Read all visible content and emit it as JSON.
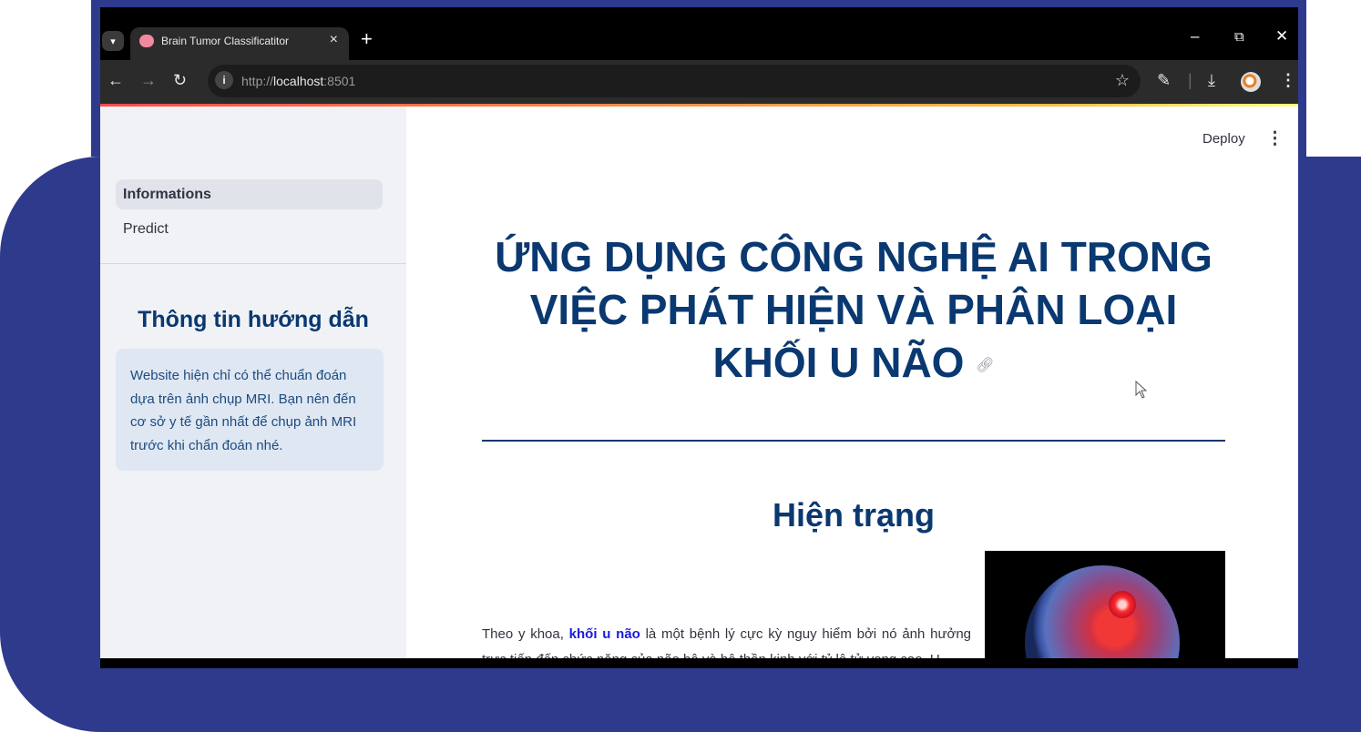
{
  "colors": {
    "backdrop": "#2e3a8c",
    "heading": "#0a3870",
    "sidebar_bg": "#f0f2f6",
    "info_box_bg": "#dfe7f2"
  },
  "browser": {
    "tab_title": "Brain Tumor Classificatitor",
    "url_scheme": "http://",
    "url_host": "localhost",
    "url_port": ":8501",
    "icons": [
      "tab-search-icon",
      "brain-favicon-icon",
      "close-icon",
      "new-tab-icon",
      "minimize-icon",
      "restore-icon",
      "window-close-icon",
      "back-icon",
      "forward-icon",
      "reload-icon",
      "site-info-icon",
      "bookmark-star-icon",
      "extensions-icon",
      "download-icon",
      "profile-avatar",
      "browser-menu-icon"
    ]
  },
  "app": {
    "deploy_label": "Deploy",
    "sidebar": {
      "nav": [
        {
          "label": "Informations",
          "active": true
        },
        {
          "label": "Predict",
          "active": false
        }
      ],
      "heading": "Thông tin hướng dẫn",
      "info_text": "Website hiện chỉ có thể chuẩn đoán dựa trên ảnh chụp MRI. Bạn nên đến cơ sở y tế gần nhất để chụp ảnh MRI trước khi chẩn đoán nhé."
    },
    "main": {
      "title": "ỨNG DỤNG CÔNG NGHỆ AI TRONG VIỆC PHÁT HIỆN VÀ PHÂN LOẠI KHỐI U NÃO",
      "section_heading": "Hiện trạng",
      "body_prefix": "Theo y khoa, ",
      "body_highlight": "khối u não",
      "body_rest": " là một bệnh lý cực kỳ nguy hiểm bởi nó ảnh hưởng trực tiếp đến chức năng của não bộ và hệ thần kinh với tỷ lệ tử vong cao. U"
    }
  }
}
